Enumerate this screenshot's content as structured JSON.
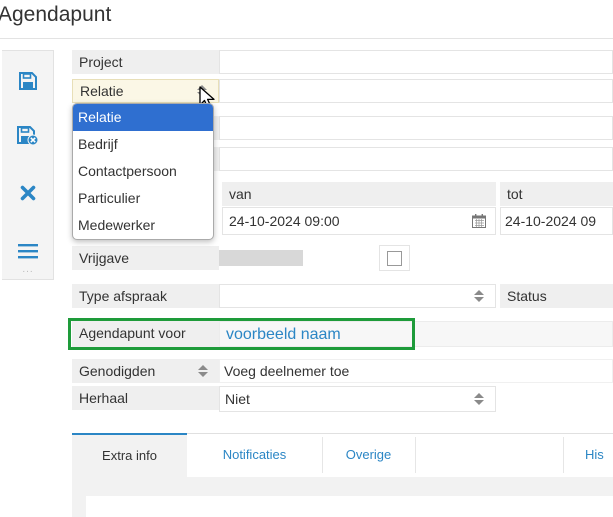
{
  "page": {
    "title": "Agendapunt"
  },
  "toolbar": {
    "icons": [
      "save-icon",
      "save-close-icon",
      "close-icon",
      "menu-icon"
    ],
    "dots": "..."
  },
  "form": {
    "project": {
      "label": "Project",
      "value": ""
    },
    "relatie": {
      "label": "Relatie",
      "value": ""
    },
    "dropdown": {
      "selected": "Relatie",
      "options": [
        "Relatie",
        "Bedrijf",
        "Contactpersoon",
        "Particulier",
        "Medewerker"
      ]
    },
    "van": {
      "label": "van",
      "value": "24-10-2024 09:00"
    },
    "tot": {
      "label": "tot",
      "value": "24-10-2024 09"
    },
    "vrijgave": {
      "label": "Vrijgave",
      "checked": false
    },
    "type_afspraak": {
      "label": "Type afspraak",
      "value": ""
    },
    "status": {
      "label": "Status"
    },
    "agendapunt_voor": {
      "label": "Agendapunt voor",
      "value": "voorbeeld naam"
    },
    "genodigden": {
      "label": "Genodigden",
      "placeholder": "Voeg deelnemer toe"
    },
    "herhaal": {
      "label": "Herhaal",
      "value": "Niet"
    }
  },
  "tabs": [
    {
      "label": "Extra info",
      "active": true
    },
    {
      "label": "Notificaties",
      "active": false
    },
    {
      "label": "Overige",
      "active": false
    },
    {
      "label": "His",
      "active": false
    }
  ],
  "colors": {
    "accent": "#2b86c5",
    "highlight": "#1e9b3a",
    "selected": "#2f6fd0"
  }
}
